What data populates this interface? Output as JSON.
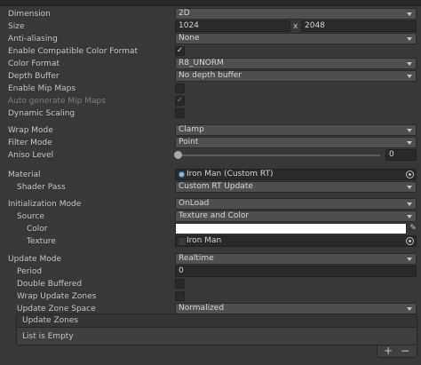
{
  "rows": {
    "dimension": {
      "label": "Dimension",
      "value": "2D"
    },
    "size": {
      "label": "Size",
      "width": "1024",
      "x": "x",
      "height": "2048"
    },
    "anti_aliasing": {
      "label": "Anti-aliasing",
      "value": "None"
    },
    "enable_compatible_color_format": {
      "label": "Enable Compatible Color Format",
      "checked": "✓"
    },
    "color_format": {
      "label": "Color Format",
      "value": "R8_UNORM"
    },
    "depth_buffer": {
      "label": "Depth Buffer",
      "value": "No depth buffer"
    },
    "enable_mip_maps": {
      "label": "Enable Mip Maps"
    },
    "auto_generate_mip_maps": {
      "label": "Auto generate Mip Maps",
      "checked": "✓"
    },
    "dynamic_scaling": {
      "label": "Dynamic Scaling"
    },
    "wrap_mode": {
      "label": "Wrap Mode",
      "value": "Clamp"
    },
    "filter_mode": {
      "label": "Filter Mode",
      "value": "Point"
    },
    "aniso_level": {
      "label": "Aniso Level",
      "value": "0",
      "level": 0
    },
    "material": {
      "label": "Material",
      "value": "Iron Man (Custom RT)"
    },
    "shader_pass": {
      "label": "Shader Pass",
      "value": "Custom RT Update"
    },
    "initialization_mode": {
      "label": "Initialization Mode",
      "value": "OnLoad"
    },
    "source": {
      "label": "Source",
      "value": "Texture and Color"
    },
    "color": {
      "label": "Color",
      "swatch": "#ffffff"
    },
    "texture": {
      "label": "Texture",
      "value": "Iron Man"
    },
    "update_mode": {
      "label": "Update Mode",
      "value": "Realtime"
    },
    "period": {
      "label": "Period",
      "value": "0"
    },
    "double_buffered": {
      "label": "Double Buffered"
    },
    "wrap_update_zones": {
      "label": "Wrap Update Zones"
    },
    "update_zone_space": {
      "label": "Update Zone Space",
      "value": "Normalized"
    }
  },
  "update_zones": {
    "header": "Update Zones",
    "empty_text": "List is Empty",
    "add_label": "+",
    "remove_label": "−"
  },
  "icons": {
    "eyedropper": "✎"
  }
}
